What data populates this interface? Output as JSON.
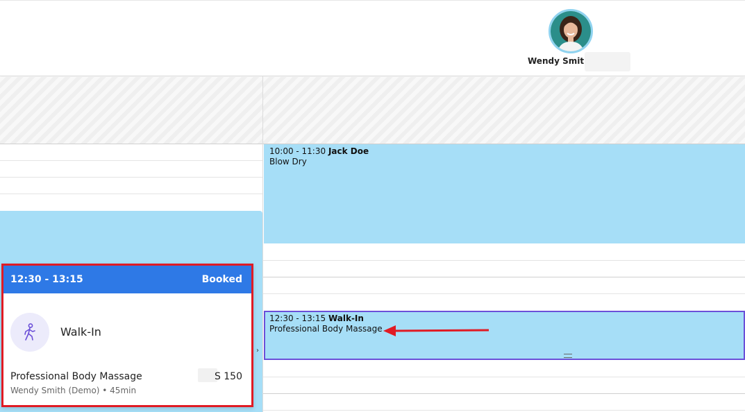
{
  "header": {
    "staff": {
      "name": "Wendy Smith",
      "avatar": "avatar-photo"
    }
  },
  "calendar": {
    "appointments": [
      {
        "time": "10:00 - 11:30",
        "client": "Jack Doe",
        "service": "Blow Dry",
        "color": "#a6def7"
      },
      {
        "time": "12:30 - 13:15",
        "client": "Walk-In",
        "service": "Professional Body Massage",
        "color": "#a6def7",
        "selected_border": "#6b4fd8"
      }
    ]
  },
  "popup": {
    "time": "12:30 - 13:15",
    "status": "Booked",
    "header_color": "#2e79e6",
    "client_icon": "walk-in-icon",
    "client": "Walk-In",
    "service": "Professional Body Massage",
    "price": "S 150",
    "details": "Wendy Smith (Demo) • 45min"
  },
  "annotations": {
    "highlight_color": "#e01b24",
    "arrow_icon": "arrow-left-icon"
  }
}
